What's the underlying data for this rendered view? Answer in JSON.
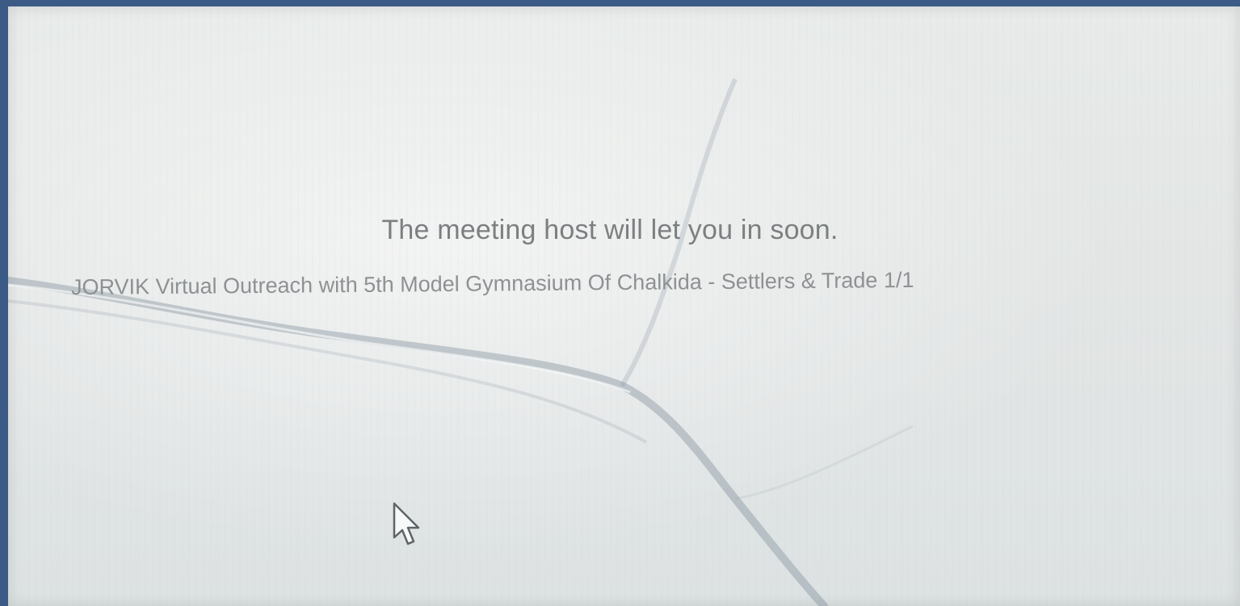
{
  "window": {
    "waiting_message": "The meeting host will let you in soon.",
    "meeting_topic": "JORVIK Virtual Outreach with 5th Model Gymnasium Of Chalkida - Settlers & Trade 1/1"
  },
  "icons": {
    "cursor": "mouse-pointer-icon"
  },
  "colors": {
    "screen_border": "#3b5a86",
    "background": "#e4e7e6",
    "primary_text": "#7c7f80",
    "secondary_text": "#8e9193"
  }
}
